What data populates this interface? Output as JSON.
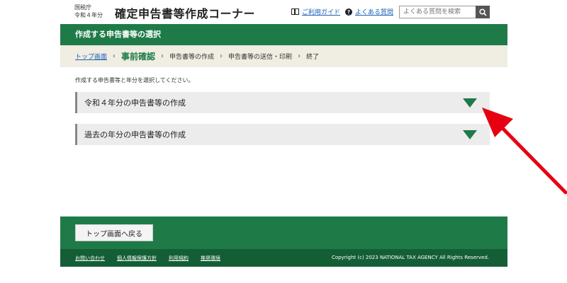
{
  "header": {
    "agency_name": "国税庁",
    "year_label": "令和４年分",
    "site_title": "確定申告書等作成コーナー",
    "help_link": "ご利用ガイド",
    "faq_link": "よくある質問",
    "search_placeholder": "よくある質問を検索"
  },
  "title_bar": {
    "title": "作成する申告書等の選択"
  },
  "breadcrumb": {
    "items": [
      {
        "label": "トップ画面"
      },
      {
        "label": "事前確認"
      },
      {
        "label": "申告書等の作成"
      },
      {
        "label": "申告書等の送信・印刷"
      },
      {
        "label": "終了"
      }
    ]
  },
  "main": {
    "instruction": "作成する申告書等と年分を選択してください。",
    "accordions": [
      {
        "label": "令和４年分の申告書等の作成"
      },
      {
        "label": "過去の年分の申告書等の作成"
      }
    ]
  },
  "footer": {
    "back_button": "トップ画面へ戻る",
    "links": [
      {
        "label": "お問い合わせ"
      },
      {
        "label": "個人情報保護方針"
      },
      {
        "label": "利用規約"
      },
      {
        "label": "推奨環境"
      }
    ],
    "copyright": "Copyright (c) 2023 NATIONAL TAX AGENCY All Rights Reserved."
  },
  "colors": {
    "primary_green": "#1e7b48",
    "dark_green": "#145e36",
    "breadcrumb_bg": "#f0ede3",
    "annotation_red": "#e60012"
  }
}
